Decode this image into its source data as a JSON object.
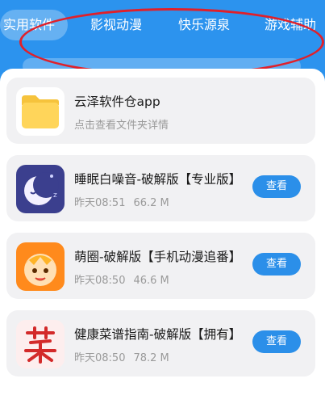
{
  "tabs": [
    {
      "label": "实用软件",
      "active": true
    },
    {
      "label": "影视动漫",
      "active": false
    },
    {
      "label": "快乐源泉",
      "active": false
    },
    {
      "label": "游戏辅助",
      "active": false
    }
  ],
  "folder": {
    "title": "云泽软件仓app",
    "subtitle": "点击查看文件夹详情",
    "icon": "folder-icon"
  },
  "apps": [
    {
      "title": "睡眠白噪音-破解版【专业版】",
      "time": "昨天08:51",
      "size": "66.2 M",
      "button": "查看",
      "icon": "moon-app-icon"
    },
    {
      "title": "萌圈-破解版【手机动漫追番】",
      "time": "昨天08:50",
      "size": "46.6 M",
      "button": "查看",
      "icon": "cartoon-face-app-icon"
    },
    {
      "title": "健康菜谱指南-破解版【拥有】",
      "time": "昨天08:50",
      "size": "78.2 M",
      "button": "查看",
      "icon": "cai-character-app-icon"
    }
  ],
  "colors": {
    "accent": "#2c93ee",
    "button": "#2b8fe9",
    "annotation_oval": "#e0202a"
  }
}
